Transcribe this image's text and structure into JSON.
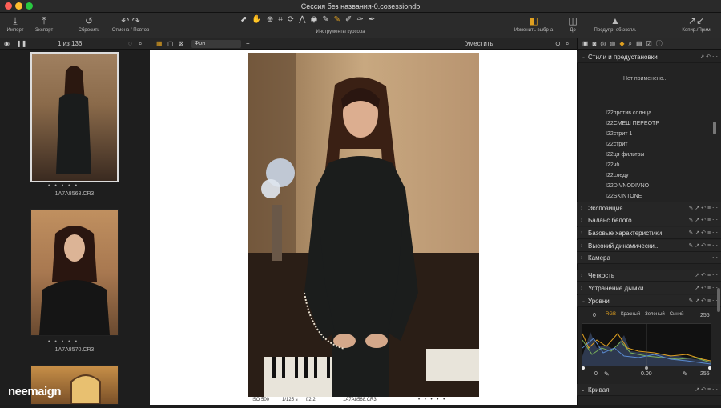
{
  "window": {
    "title": "Сессия без названия-0.cosessiondb"
  },
  "toolbar": {
    "import": "Импорт",
    "export": "Экспорт",
    "reset": "Сбросить",
    "undo_redo": "Отмена / Повтор",
    "cursor_tools": "Инструменты курсора",
    "change_variant": "Изменить выбр-а",
    "before": "До",
    "exposure_warning": "Предупр. об экспл.",
    "copy_apply": "Копир./Прим"
  },
  "browser": {
    "counter": "1 из 136",
    "thumbnails": [
      {
        "filename": "1A7A8568.CR3"
      },
      {
        "filename": "1A7A8570.CR3"
      },
      {
        "filename": ""
      }
    ],
    "rating_dots": "• • • • •"
  },
  "viewer": {
    "background_label": "Фон",
    "fit_label": "Уместить",
    "status": {
      "iso": "ISO 500",
      "shutter": "1/125 s",
      "aperture": "f/2.2",
      "filename": "1A7A8568.CR3"
    }
  },
  "right_panel": {
    "styles_title": "Стили и предустановки",
    "styles_empty": "Нет применено...",
    "styles_list": [
      "I22против солнца",
      "I22СМЕШ ПЕРЕОТР",
      "I22стрит 1",
      "I22стрит",
      "I22ця фильтры",
      "I22чб",
      "I22следу",
      "I22DIVNODIVNO",
      "I22SKINTONE"
    ],
    "sections": [
      "Экспозиция",
      "Баланс белого",
      "Базовые характеристики",
      "Высокий динамически...",
      "Камера",
      "Четкость",
      "Устранение дымки",
      "Уровни"
    ],
    "levels": {
      "channels": [
        "RGB",
        "Красный",
        "Зеленый",
        "Синий"
      ],
      "in_low": "0",
      "in_high": "255",
      "out_low": "0",
      "mid": "0.00",
      "out_high": "255"
    },
    "curve_title": "Кривая"
  },
  "watermark": "neemaign",
  "colors": {
    "accent": "#e0a020",
    "panel": "#232323"
  }
}
